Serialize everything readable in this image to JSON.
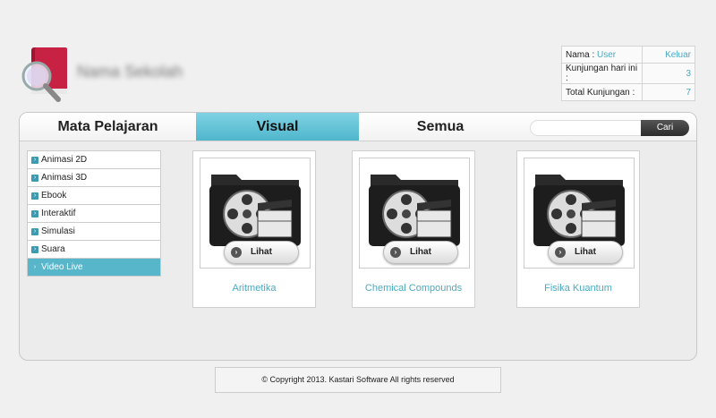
{
  "header": {
    "school_name": "Nama Sekolah",
    "stats": {
      "name_label": "Nama : ",
      "user": "User",
      "logout": "Keluar",
      "visits_today_label": "Kunjungan hari ini :",
      "visits_today": "3",
      "total_visits_label": "Total Kunjungan :",
      "total_visits": "7"
    }
  },
  "tabs": {
    "mapel": "Mata Pelajaran",
    "visual": "Visual",
    "semua": "Semua"
  },
  "search": {
    "placeholder": "",
    "button": "Cari"
  },
  "sidebar": {
    "items": [
      {
        "label": "Animasi 2D"
      },
      {
        "label": "Animasi 3D"
      },
      {
        "label": "Ebook"
      },
      {
        "label": "Interaktif"
      },
      {
        "label": "Simulasi"
      },
      {
        "label": "Suara"
      },
      {
        "label": "Video Live"
      }
    ],
    "active_index": 6
  },
  "cards": [
    {
      "title": "Aritmetika",
      "button": "Lihat"
    },
    {
      "title": "Chemical Compounds",
      "button": "Lihat"
    },
    {
      "title": "Fisika Kuantum",
      "button": "Lihat"
    }
  ],
  "footer": {
    "text": "© Copyright 2013. Kastari Software All rights reserved"
  },
  "colors": {
    "accent": "#58b6cb",
    "link": "#4aaac2"
  }
}
